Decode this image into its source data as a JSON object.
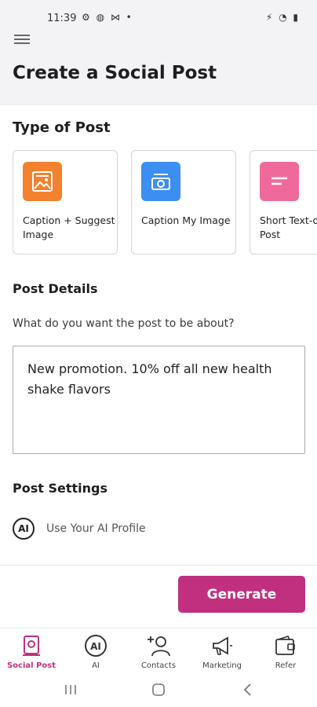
{
  "status_bar": {
    "time": "11:39",
    "left_icons": "⚙ ◍ ⋈ •",
    "right_icons": "⚡ ◔ ▮"
  },
  "header": {
    "title": "Create a Social Post"
  },
  "post_type": {
    "title": "Type of Post",
    "cards": [
      {
        "label": "Caption + Suggest Image",
        "icon": "image-icon",
        "color": "#f2822e"
      },
      {
        "label": "Caption My Image",
        "icon": "camera-icon",
        "color": "#3c8ef2"
      },
      {
        "label": "Short Text-o Post",
        "icon": "text-icon",
        "color": "#ef6a9b"
      }
    ]
  },
  "post_details": {
    "title": "Post Details",
    "question": "What do you want the post to be about?",
    "input_value": "New promotion. 10% off all new health shake flavors"
  },
  "post_settings": {
    "title": "Post Settings",
    "ai_badge": "AI",
    "ai_profile_label": "Use Your AI Profile"
  },
  "actions": {
    "generate_label": "Generate"
  },
  "bottom_nav": {
    "items": [
      {
        "label": "Social Post",
        "icon": "social-post-icon",
        "active": true
      },
      {
        "label": "AI",
        "icon": "ai-icon",
        "active": false
      },
      {
        "label": "Contacts",
        "icon": "contacts-icon",
        "active": false
      },
      {
        "label": "Marketing",
        "icon": "megaphone-icon",
        "active": false
      },
      {
        "label": "Refer",
        "icon": "wallet-icon",
        "active": false
      }
    ]
  },
  "colors": {
    "accent": "#c0307f",
    "header_bg": "#f3f3f6"
  }
}
